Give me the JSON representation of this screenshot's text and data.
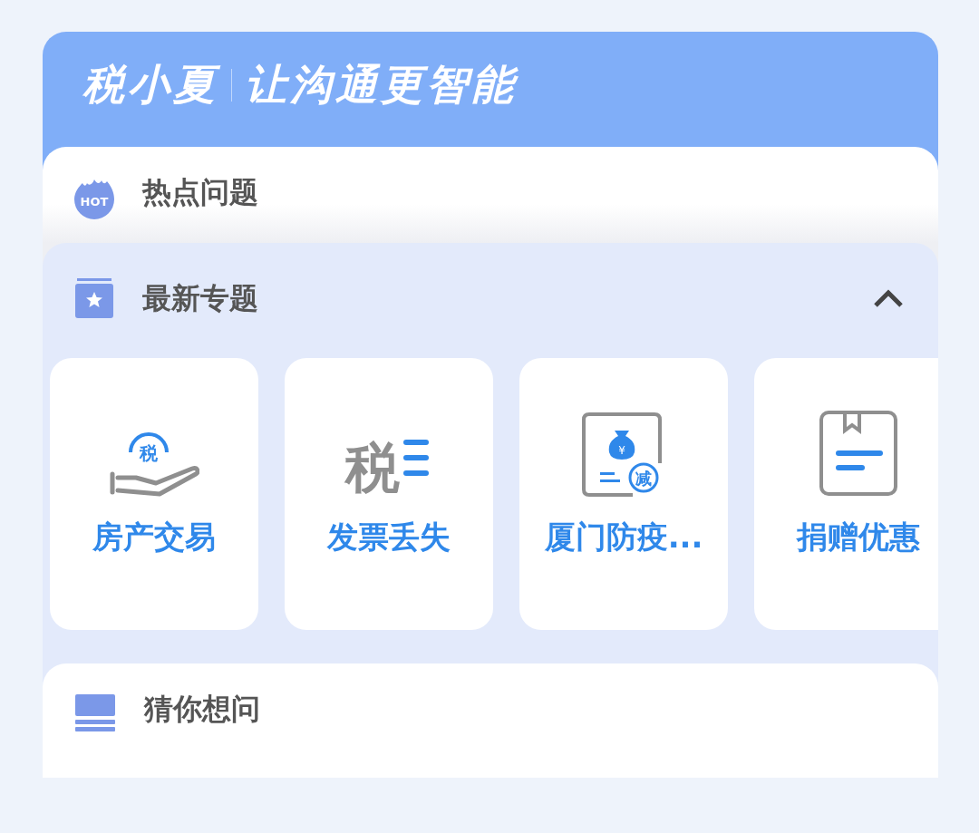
{
  "banner": {
    "brand": "税小夏",
    "slogan": "让沟通更智能"
  },
  "sections": [
    {
      "kind": "hot",
      "title": "热点问题",
      "icon_text": "HOT"
    },
    {
      "kind": "topics",
      "title": "最新专题",
      "expanded": true,
      "tiles": [
        {
          "kind": "hand",
          "label": "房产交易",
          "icon_text": [
            "税"
          ]
        },
        {
          "kind": "tax-lines",
          "label": "发票丢失",
          "icon_text": [
            "税"
          ]
        },
        {
          "kind": "money-bag",
          "label": "厦门防疫...",
          "icon_text": [
            "¥",
            "减"
          ]
        },
        {
          "kind": "document",
          "label": "捐赠优惠"
        }
      ]
    },
    {
      "kind": "guess",
      "title": "猜你想问"
    }
  ]
}
